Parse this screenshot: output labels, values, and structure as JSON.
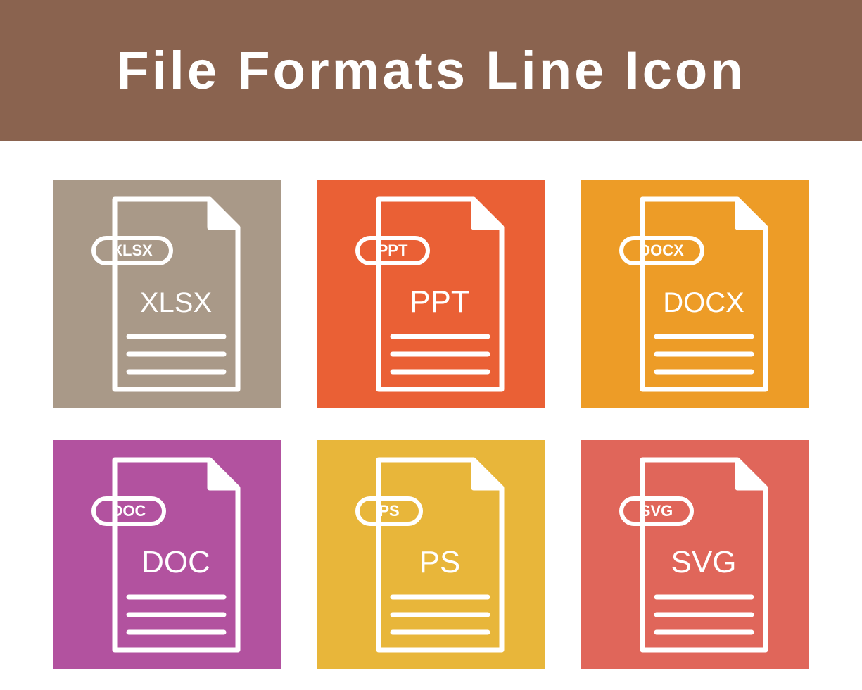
{
  "header": {
    "title": "File Formats Line Icon"
  },
  "tiles": [
    {
      "bg": "#a99988",
      "tag": "XLSX",
      "center": "XLSX"
    },
    {
      "bg": "#ea6035",
      "tag": "PPT",
      "center": "PPT"
    },
    {
      "bg": "#ed9c27",
      "tag": "DOCX",
      "center": "DOCX"
    },
    {
      "bg": "#b2529f",
      "tag": "DOC",
      "center": "DOC"
    },
    {
      "bg": "#e8b63a",
      "tag": "PS",
      "center": "PS"
    },
    {
      "bg": "#e0665a",
      "tag": "SVG",
      "center": "SVG"
    }
  ]
}
